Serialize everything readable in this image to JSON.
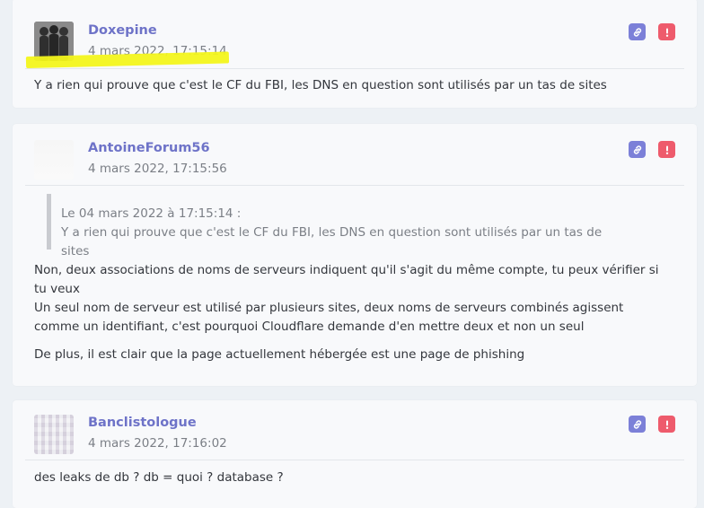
{
  "posts": [
    {
      "author": "Doxepine",
      "timestamp": "4 mars 2022, 17:15:14",
      "avatar_icon": "avatar-silhouette-icon",
      "body": [
        "Y a rien qui prouve que c'est le CF du FBI, les DNS en question sont utilisés par un tas de sites"
      ]
    },
    {
      "author": "AntoineForum56",
      "timestamp": "4 mars 2022, 17:15:56",
      "avatar_icon": "avatar-blank-icon",
      "quote": {
        "header": "Le 04 mars 2022 à 17:15:14 :",
        "text": "Y a rien qui prouve que c'est le CF du FBI, les DNS en question sont utilisés par un tas de sites"
      },
      "body": [
        "Non, deux associations de noms de serveurs indiquent qu'il s'agit du même compte, tu peux vérifier si tu veux",
        "Un seul nom de serveur est utilisé par plusieurs sites, deux noms de serveurs combinés agissent comme un identifiant, c'est pourquoi Cloudflare demande d'en mettre deux et non un seul",
        "De plus, il est clair que la page actuellement hébergée est une page de phishing"
      ]
    },
    {
      "author": "Banclistologue",
      "timestamp": "4 mars 2022, 17:16:02",
      "avatar_icon": "avatar-pixel-icon",
      "body": [
        "des leaks de db ? db = quoi ? database ?"
      ]
    }
  ],
  "actions": {
    "link_icon": "link-icon",
    "report_icon": "report-icon"
  },
  "colors": {
    "username": "#6e73c8",
    "link_button": "#7c80d8",
    "report_button": "#ee5b6c",
    "highlight": "#f3f51c",
    "background": "#edf1f5"
  }
}
